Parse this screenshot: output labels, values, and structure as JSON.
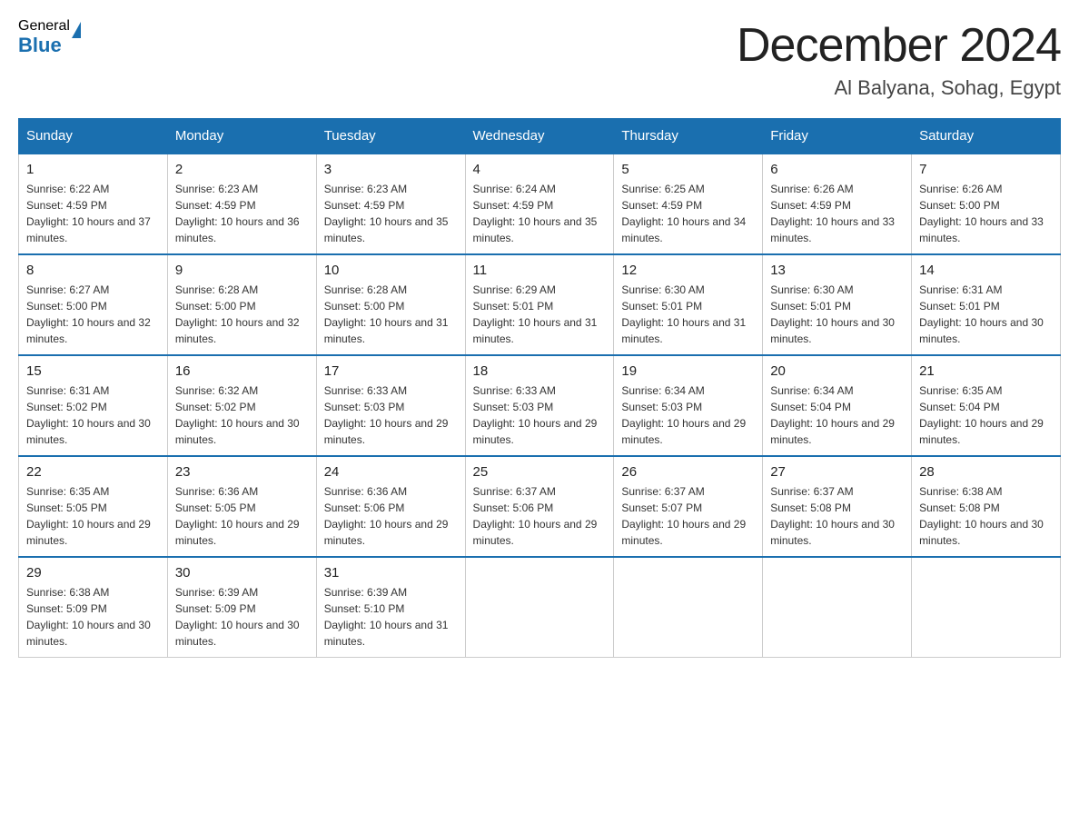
{
  "header": {
    "logo": {
      "general": "General",
      "blue": "Blue"
    },
    "month_title": "December 2024",
    "location": "Al Balyana, Sohag, Egypt"
  },
  "days_of_week": [
    "Sunday",
    "Monday",
    "Tuesday",
    "Wednesday",
    "Thursday",
    "Friday",
    "Saturday"
  ],
  "weeks": [
    [
      {
        "day": "1",
        "sunrise": "6:22 AM",
        "sunset": "4:59 PM",
        "daylight": "10 hours and 37 minutes."
      },
      {
        "day": "2",
        "sunrise": "6:23 AM",
        "sunset": "4:59 PM",
        "daylight": "10 hours and 36 minutes."
      },
      {
        "day": "3",
        "sunrise": "6:23 AM",
        "sunset": "4:59 PM",
        "daylight": "10 hours and 35 minutes."
      },
      {
        "day": "4",
        "sunrise": "6:24 AM",
        "sunset": "4:59 PM",
        "daylight": "10 hours and 35 minutes."
      },
      {
        "day": "5",
        "sunrise": "6:25 AM",
        "sunset": "4:59 PM",
        "daylight": "10 hours and 34 minutes."
      },
      {
        "day": "6",
        "sunrise": "6:26 AM",
        "sunset": "4:59 PM",
        "daylight": "10 hours and 33 minutes."
      },
      {
        "day": "7",
        "sunrise": "6:26 AM",
        "sunset": "5:00 PM",
        "daylight": "10 hours and 33 minutes."
      }
    ],
    [
      {
        "day": "8",
        "sunrise": "6:27 AM",
        "sunset": "5:00 PM",
        "daylight": "10 hours and 32 minutes."
      },
      {
        "day": "9",
        "sunrise": "6:28 AM",
        "sunset": "5:00 PM",
        "daylight": "10 hours and 32 minutes."
      },
      {
        "day": "10",
        "sunrise": "6:28 AM",
        "sunset": "5:00 PM",
        "daylight": "10 hours and 31 minutes."
      },
      {
        "day": "11",
        "sunrise": "6:29 AM",
        "sunset": "5:01 PM",
        "daylight": "10 hours and 31 minutes."
      },
      {
        "day": "12",
        "sunrise": "6:30 AM",
        "sunset": "5:01 PM",
        "daylight": "10 hours and 31 minutes."
      },
      {
        "day": "13",
        "sunrise": "6:30 AM",
        "sunset": "5:01 PM",
        "daylight": "10 hours and 30 minutes."
      },
      {
        "day": "14",
        "sunrise": "6:31 AM",
        "sunset": "5:01 PM",
        "daylight": "10 hours and 30 minutes."
      }
    ],
    [
      {
        "day": "15",
        "sunrise": "6:31 AM",
        "sunset": "5:02 PM",
        "daylight": "10 hours and 30 minutes."
      },
      {
        "day": "16",
        "sunrise": "6:32 AM",
        "sunset": "5:02 PM",
        "daylight": "10 hours and 30 minutes."
      },
      {
        "day": "17",
        "sunrise": "6:33 AM",
        "sunset": "5:03 PM",
        "daylight": "10 hours and 29 minutes."
      },
      {
        "day": "18",
        "sunrise": "6:33 AM",
        "sunset": "5:03 PM",
        "daylight": "10 hours and 29 minutes."
      },
      {
        "day": "19",
        "sunrise": "6:34 AM",
        "sunset": "5:03 PM",
        "daylight": "10 hours and 29 minutes."
      },
      {
        "day": "20",
        "sunrise": "6:34 AM",
        "sunset": "5:04 PM",
        "daylight": "10 hours and 29 minutes."
      },
      {
        "day": "21",
        "sunrise": "6:35 AM",
        "sunset": "5:04 PM",
        "daylight": "10 hours and 29 minutes."
      }
    ],
    [
      {
        "day": "22",
        "sunrise": "6:35 AM",
        "sunset": "5:05 PM",
        "daylight": "10 hours and 29 minutes."
      },
      {
        "day": "23",
        "sunrise": "6:36 AM",
        "sunset": "5:05 PM",
        "daylight": "10 hours and 29 minutes."
      },
      {
        "day": "24",
        "sunrise": "6:36 AM",
        "sunset": "5:06 PM",
        "daylight": "10 hours and 29 minutes."
      },
      {
        "day": "25",
        "sunrise": "6:37 AM",
        "sunset": "5:06 PM",
        "daylight": "10 hours and 29 minutes."
      },
      {
        "day": "26",
        "sunrise": "6:37 AM",
        "sunset": "5:07 PM",
        "daylight": "10 hours and 29 minutes."
      },
      {
        "day": "27",
        "sunrise": "6:37 AM",
        "sunset": "5:08 PM",
        "daylight": "10 hours and 30 minutes."
      },
      {
        "day": "28",
        "sunrise": "6:38 AM",
        "sunset": "5:08 PM",
        "daylight": "10 hours and 30 minutes."
      }
    ],
    [
      {
        "day": "29",
        "sunrise": "6:38 AM",
        "sunset": "5:09 PM",
        "daylight": "10 hours and 30 minutes."
      },
      {
        "day": "30",
        "sunrise": "6:39 AM",
        "sunset": "5:09 PM",
        "daylight": "10 hours and 30 minutes."
      },
      {
        "day": "31",
        "sunrise": "6:39 AM",
        "sunset": "5:10 PM",
        "daylight": "10 hours and 31 minutes."
      },
      null,
      null,
      null,
      null
    ]
  ]
}
